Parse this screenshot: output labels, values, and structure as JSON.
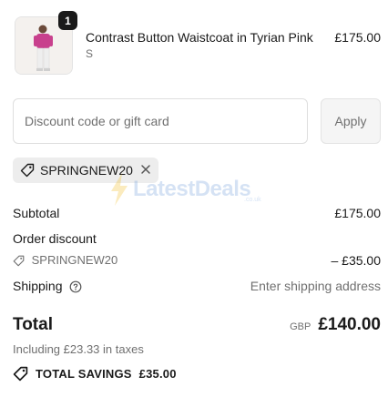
{
  "line_item": {
    "quantity": "1",
    "name": "Contrast Button Waistcoat in Tyrian Pink",
    "variant": "S",
    "price": "£175.00",
    "image_icon": "product-photo"
  },
  "discount": {
    "placeholder": "Discount code or gift card",
    "apply_label": "Apply",
    "applied_code": "SPRINGNEW20",
    "tag_icon": "tag-icon",
    "remove_icon": "close-icon"
  },
  "summary": {
    "subtotal_label": "Subtotal",
    "subtotal_value": "£175.00",
    "order_discount_label": "Order discount",
    "discount_code": "SPRINGNEW20",
    "discount_value": "– £35.00",
    "shipping_label": "Shipping",
    "shipping_value": "Enter shipping address",
    "total_label": "Total",
    "currency": "GBP",
    "total_value": "£140.00",
    "taxes_text": "Including £23.33 in taxes",
    "savings_label": "TOTAL SAVINGS",
    "savings_value": "£35.00"
  },
  "watermark": {
    "text": "LatestDeals",
    "sub": ".co.uk"
  },
  "colors": {
    "text": "#1a1a1a",
    "muted": "#707070",
    "chip_bg": "#ededed",
    "product_pink": "#c8408d"
  }
}
